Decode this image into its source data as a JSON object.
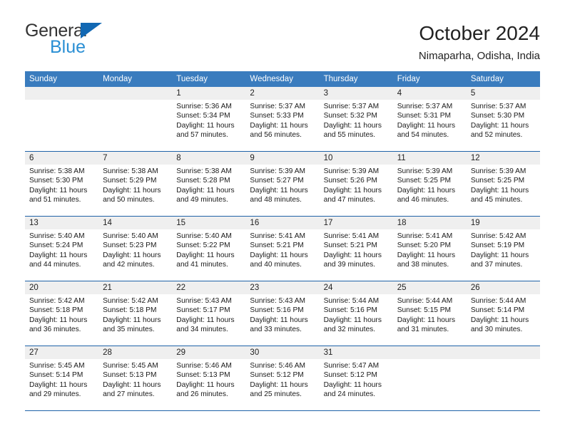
{
  "brand": {
    "name_top": "General",
    "name_bottom": "Blue",
    "triangle_color": "#1268b3",
    "blue_text_color": "#2a8fd4"
  },
  "header": {
    "title": "October 2024",
    "subtitle": "Nimaparha, Odisha, India"
  },
  "theme": {
    "header_row_bg": "#3a7cbe",
    "row_divider": "#1f63a8",
    "daynum_band_bg": "#efefef"
  },
  "weekday_headers": [
    "Sunday",
    "Monday",
    "Tuesday",
    "Wednesday",
    "Thursday",
    "Friday",
    "Saturday"
  ],
  "labels": {
    "sunrise_prefix": "Sunrise:",
    "sunset_prefix": "Sunset:",
    "daylight_prefix": "Daylight:"
  },
  "weeks": [
    [
      {
        "day": "",
        "empty": true
      },
      {
        "day": "",
        "empty": true
      },
      {
        "day": "1",
        "sunrise": "Sunrise: 5:36 AM",
        "sunset": "Sunset: 5:34 PM",
        "daylight": "Daylight: 11 hours and 57 minutes."
      },
      {
        "day": "2",
        "sunrise": "Sunrise: 5:37 AM",
        "sunset": "Sunset: 5:33 PM",
        "daylight": "Daylight: 11 hours and 56 minutes."
      },
      {
        "day": "3",
        "sunrise": "Sunrise: 5:37 AM",
        "sunset": "Sunset: 5:32 PM",
        "daylight": "Daylight: 11 hours and 55 minutes."
      },
      {
        "day": "4",
        "sunrise": "Sunrise: 5:37 AM",
        "sunset": "Sunset: 5:31 PM",
        "daylight": "Daylight: 11 hours and 54 minutes."
      },
      {
        "day": "5",
        "sunrise": "Sunrise: 5:37 AM",
        "sunset": "Sunset: 5:30 PM",
        "daylight": "Daylight: 11 hours and 52 minutes."
      }
    ],
    [
      {
        "day": "6",
        "sunrise": "Sunrise: 5:38 AM",
        "sunset": "Sunset: 5:30 PM",
        "daylight": "Daylight: 11 hours and 51 minutes."
      },
      {
        "day": "7",
        "sunrise": "Sunrise: 5:38 AM",
        "sunset": "Sunset: 5:29 PM",
        "daylight": "Daylight: 11 hours and 50 minutes."
      },
      {
        "day": "8",
        "sunrise": "Sunrise: 5:38 AM",
        "sunset": "Sunset: 5:28 PM",
        "daylight": "Daylight: 11 hours and 49 minutes."
      },
      {
        "day": "9",
        "sunrise": "Sunrise: 5:39 AM",
        "sunset": "Sunset: 5:27 PM",
        "daylight": "Daylight: 11 hours and 48 minutes."
      },
      {
        "day": "10",
        "sunrise": "Sunrise: 5:39 AM",
        "sunset": "Sunset: 5:26 PM",
        "daylight": "Daylight: 11 hours and 47 minutes."
      },
      {
        "day": "11",
        "sunrise": "Sunrise: 5:39 AM",
        "sunset": "Sunset: 5:25 PM",
        "daylight": "Daylight: 11 hours and 46 minutes."
      },
      {
        "day": "12",
        "sunrise": "Sunrise: 5:39 AM",
        "sunset": "Sunset: 5:25 PM",
        "daylight": "Daylight: 11 hours and 45 minutes."
      }
    ],
    [
      {
        "day": "13",
        "sunrise": "Sunrise: 5:40 AM",
        "sunset": "Sunset: 5:24 PM",
        "daylight": "Daylight: 11 hours and 44 minutes."
      },
      {
        "day": "14",
        "sunrise": "Sunrise: 5:40 AM",
        "sunset": "Sunset: 5:23 PM",
        "daylight": "Daylight: 11 hours and 42 minutes."
      },
      {
        "day": "15",
        "sunrise": "Sunrise: 5:40 AM",
        "sunset": "Sunset: 5:22 PM",
        "daylight": "Daylight: 11 hours and 41 minutes."
      },
      {
        "day": "16",
        "sunrise": "Sunrise: 5:41 AM",
        "sunset": "Sunset: 5:21 PM",
        "daylight": "Daylight: 11 hours and 40 minutes."
      },
      {
        "day": "17",
        "sunrise": "Sunrise: 5:41 AM",
        "sunset": "Sunset: 5:21 PM",
        "daylight": "Daylight: 11 hours and 39 minutes."
      },
      {
        "day": "18",
        "sunrise": "Sunrise: 5:41 AM",
        "sunset": "Sunset: 5:20 PM",
        "daylight": "Daylight: 11 hours and 38 minutes."
      },
      {
        "day": "19",
        "sunrise": "Sunrise: 5:42 AM",
        "sunset": "Sunset: 5:19 PM",
        "daylight": "Daylight: 11 hours and 37 minutes."
      }
    ],
    [
      {
        "day": "20",
        "sunrise": "Sunrise: 5:42 AM",
        "sunset": "Sunset: 5:18 PM",
        "daylight": "Daylight: 11 hours and 36 minutes."
      },
      {
        "day": "21",
        "sunrise": "Sunrise: 5:42 AM",
        "sunset": "Sunset: 5:18 PM",
        "daylight": "Daylight: 11 hours and 35 minutes."
      },
      {
        "day": "22",
        "sunrise": "Sunrise: 5:43 AM",
        "sunset": "Sunset: 5:17 PM",
        "daylight": "Daylight: 11 hours and 34 minutes."
      },
      {
        "day": "23",
        "sunrise": "Sunrise: 5:43 AM",
        "sunset": "Sunset: 5:16 PM",
        "daylight": "Daylight: 11 hours and 33 minutes."
      },
      {
        "day": "24",
        "sunrise": "Sunrise: 5:44 AM",
        "sunset": "Sunset: 5:16 PM",
        "daylight": "Daylight: 11 hours and 32 minutes."
      },
      {
        "day": "25",
        "sunrise": "Sunrise: 5:44 AM",
        "sunset": "Sunset: 5:15 PM",
        "daylight": "Daylight: 11 hours and 31 minutes."
      },
      {
        "day": "26",
        "sunrise": "Sunrise: 5:44 AM",
        "sunset": "Sunset: 5:14 PM",
        "daylight": "Daylight: 11 hours and 30 minutes."
      }
    ],
    [
      {
        "day": "27",
        "sunrise": "Sunrise: 5:45 AM",
        "sunset": "Sunset: 5:14 PM",
        "daylight": "Daylight: 11 hours and 29 minutes."
      },
      {
        "day": "28",
        "sunrise": "Sunrise: 5:45 AM",
        "sunset": "Sunset: 5:13 PM",
        "daylight": "Daylight: 11 hours and 27 minutes."
      },
      {
        "day": "29",
        "sunrise": "Sunrise: 5:46 AM",
        "sunset": "Sunset: 5:13 PM",
        "daylight": "Daylight: 11 hours and 26 minutes."
      },
      {
        "day": "30",
        "sunrise": "Sunrise: 5:46 AM",
        "sunset": "Sunset: 5:12 PM",
        "daylight": "Daylight: 11 hours and 25 minutes."
      },
      {
        "day": "31",
        "sunrise": "Sunrise: 5:47 AM",
        "sunset": "Sunset: 5:12 PM",
        "daylight": "Daylight: 11 hours and 24 minutes."
      },
      {
        "day": "",
        "empty": true
      },
      {
        "day": "",
        "empty": true
      }
    ]
  ]
}
